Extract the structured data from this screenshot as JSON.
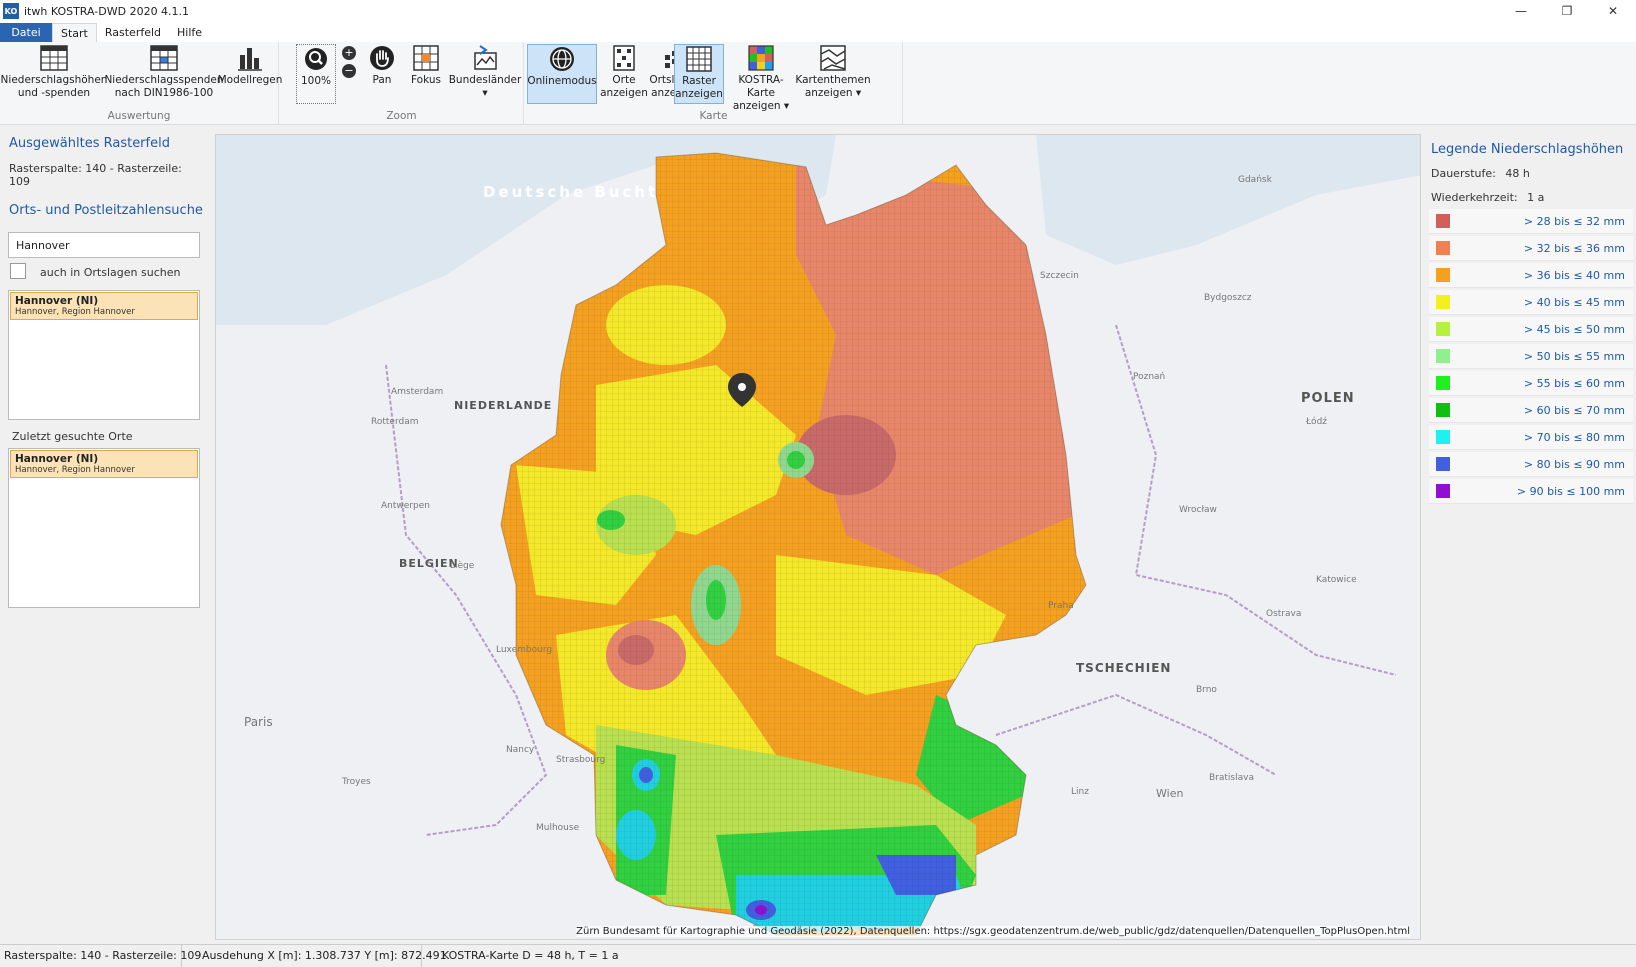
{
  "app": {
    "logo": "KO",
    "title": "itwh KOSTRA-DWD 2020 4.1.1",
    "window_controls": {
      "minimize": "—",
      "restore": "❐",
      "close": "✕"
    }
  },
  "menu": {
    "file": "Datei",
    "tabs": [
      "Start",
      "Rasterfeld",
      "Hilfe"
    ]
  },
  "ribbon": {
    "groups": {
      "auswertung": "Auswertung",
      "zoom": "Zoom",
      "karte": "Karte"
    },
    "buttons": {
      "niederschlagshoehen_l1": "Niederschlagshöhen",
      "niederschlagshoehen_l2": "und -spenden",
      "niederschlagsspenden_l1": "Niederschlagsspenden",
      "niederschlagsspenden_l2": "nach DIN1986-100",
      "modellregen": "Modellregen",
      "zoom100": "100%",
      "pan": "Pan",
      "fokus": "Fokus",
      "bundeslaender": "Bundesländer",
      "bundeslaender_arrow": "▾",
      "onlinemodus": "Onlinemodus",
      "orte_l1": "Orte",
      "orte_l2": "anzeigen",
      "ortslagen_l1": "Ortslagen",
      "ortslagen_l2": "anzeigen",
      "raster_l1": "Raster",
      "raster_l2": "anzeigen",
      "kostra_l1": "KOSTRA-Karte",
      "kostra_l2": "anzeigen ▾",
      "kartenthemen_l1": "Kartenthemen",
      "kartenthemen_l2": "anzeigen ▾"
    }
  },
  "left": {
    "selected_heading": "Ausgewähltes Rasterfeld",
    "selected_value": "Rasterspalte: 140 - Rasterzeile: 109",
    "search_heading": "Orts- und Postleitzahlensuche",
    "search_value": "Hannover",
    "checkbox_label": "auch in Ortslagen suchen",
    "result": {
      "title": "Hannover  (NI)",
      "sub": "Hannover, Region Hannover"
    },
    "recent_heading": "Zuletzt gesuchte Orte",
    "recent": {
      "title": "Hannover  (NI)",
      "sub": "Hannover, Region Hannover"
    }
  },
  "map": {
    "sea": "Deutsche Bucht",
    "countries": [
      "NIEDERLANDE",
      "BELGIEN",
      "POLEN",
      "TSCHECHIEN"
    ],
    "cities": [
      "Amsterdam",
      "Rotterdam",
      "Antwerpen",
      "Paris",
      "Strasbourg",
      "Praha",
      "Wrocław",
      "Poznań",
      "Łódź",
      "Brno",
      "Wien",
      "Bratislava",
      "Szczecin",
      "Bydgoszcz",
      "Gdańsk",
      "Mulhouse",
      "Troyes",
      "Nancy",
      "Liège",
      "Luxembourg",
      "Katowice",
      "Ostrava",
      "Linz"
    ],
    "attribution": "Bundesamt für Kartographie und Geodäsie (2022), Datenquellen: https://sgx.geodatenzentrum.de/web_public/gdz/datenquellen/Datenquellen_TopPlusOpen.html",
    "attribution_prefix": "Zürn"
  },
  "legend": {
    "title": "Legende Niederschlagshöhen",
    "dauer_label": "Dauerstufe:",
    "dauer_value": "48 h",
    "wieder_label": "Wiederkehrzeit:",
    "wieder_value": "1 a",
    "items": [
      {
        "label": "> 28 bis ≤ 32 mm",
        "color": "#d0605a"
      },
      {
        "label": "> 32 bis ≤ 36 mm",
        "color": "#f08050"
      },
      {
        "label": "> 36 bis ≤ 40 mm",
        "color": "#f4a020"
      },
      {
        "label": "> 40 bis ≤ 45 mm",
        "color": "#f4f020"
      },
      {
        "label": "> 45 bis ≤ 50 mm",
        "color": "#b8f040"
      },
      {
        "label": "> 50 bis ≤ 55 mm",
        "color": "#90f090"
      },
      {
        "label": "> 55 bis ≤ 60 mm",
        "color": "#20f020"
      },
      {
        "label": "> 60 bis ≤ 70 mm",
        "color": "#10c010"
      },
      {
        "label": "> 70 bis ≤ 80 mm",
        "color": "#20f0f0"
      },
      {
        "label": "> 80 bis ≤ 90 mm",
        "color": "#4060e0"
      },
      {
        "label": "> 90 bis ≤ 100 mm",
        "color": "#9010d0"
      }
    ]
  },
  "status": {
    "cell1": "Rasterspalte: 140 - Rasterzeile: 109",
    "cell2": "Ausdehung X [m]: 1.308.737 Y [m]: 872.491",
    "cell3": "KOSTRA-Karte D = 48 h, T = 1 a"
  }
}
